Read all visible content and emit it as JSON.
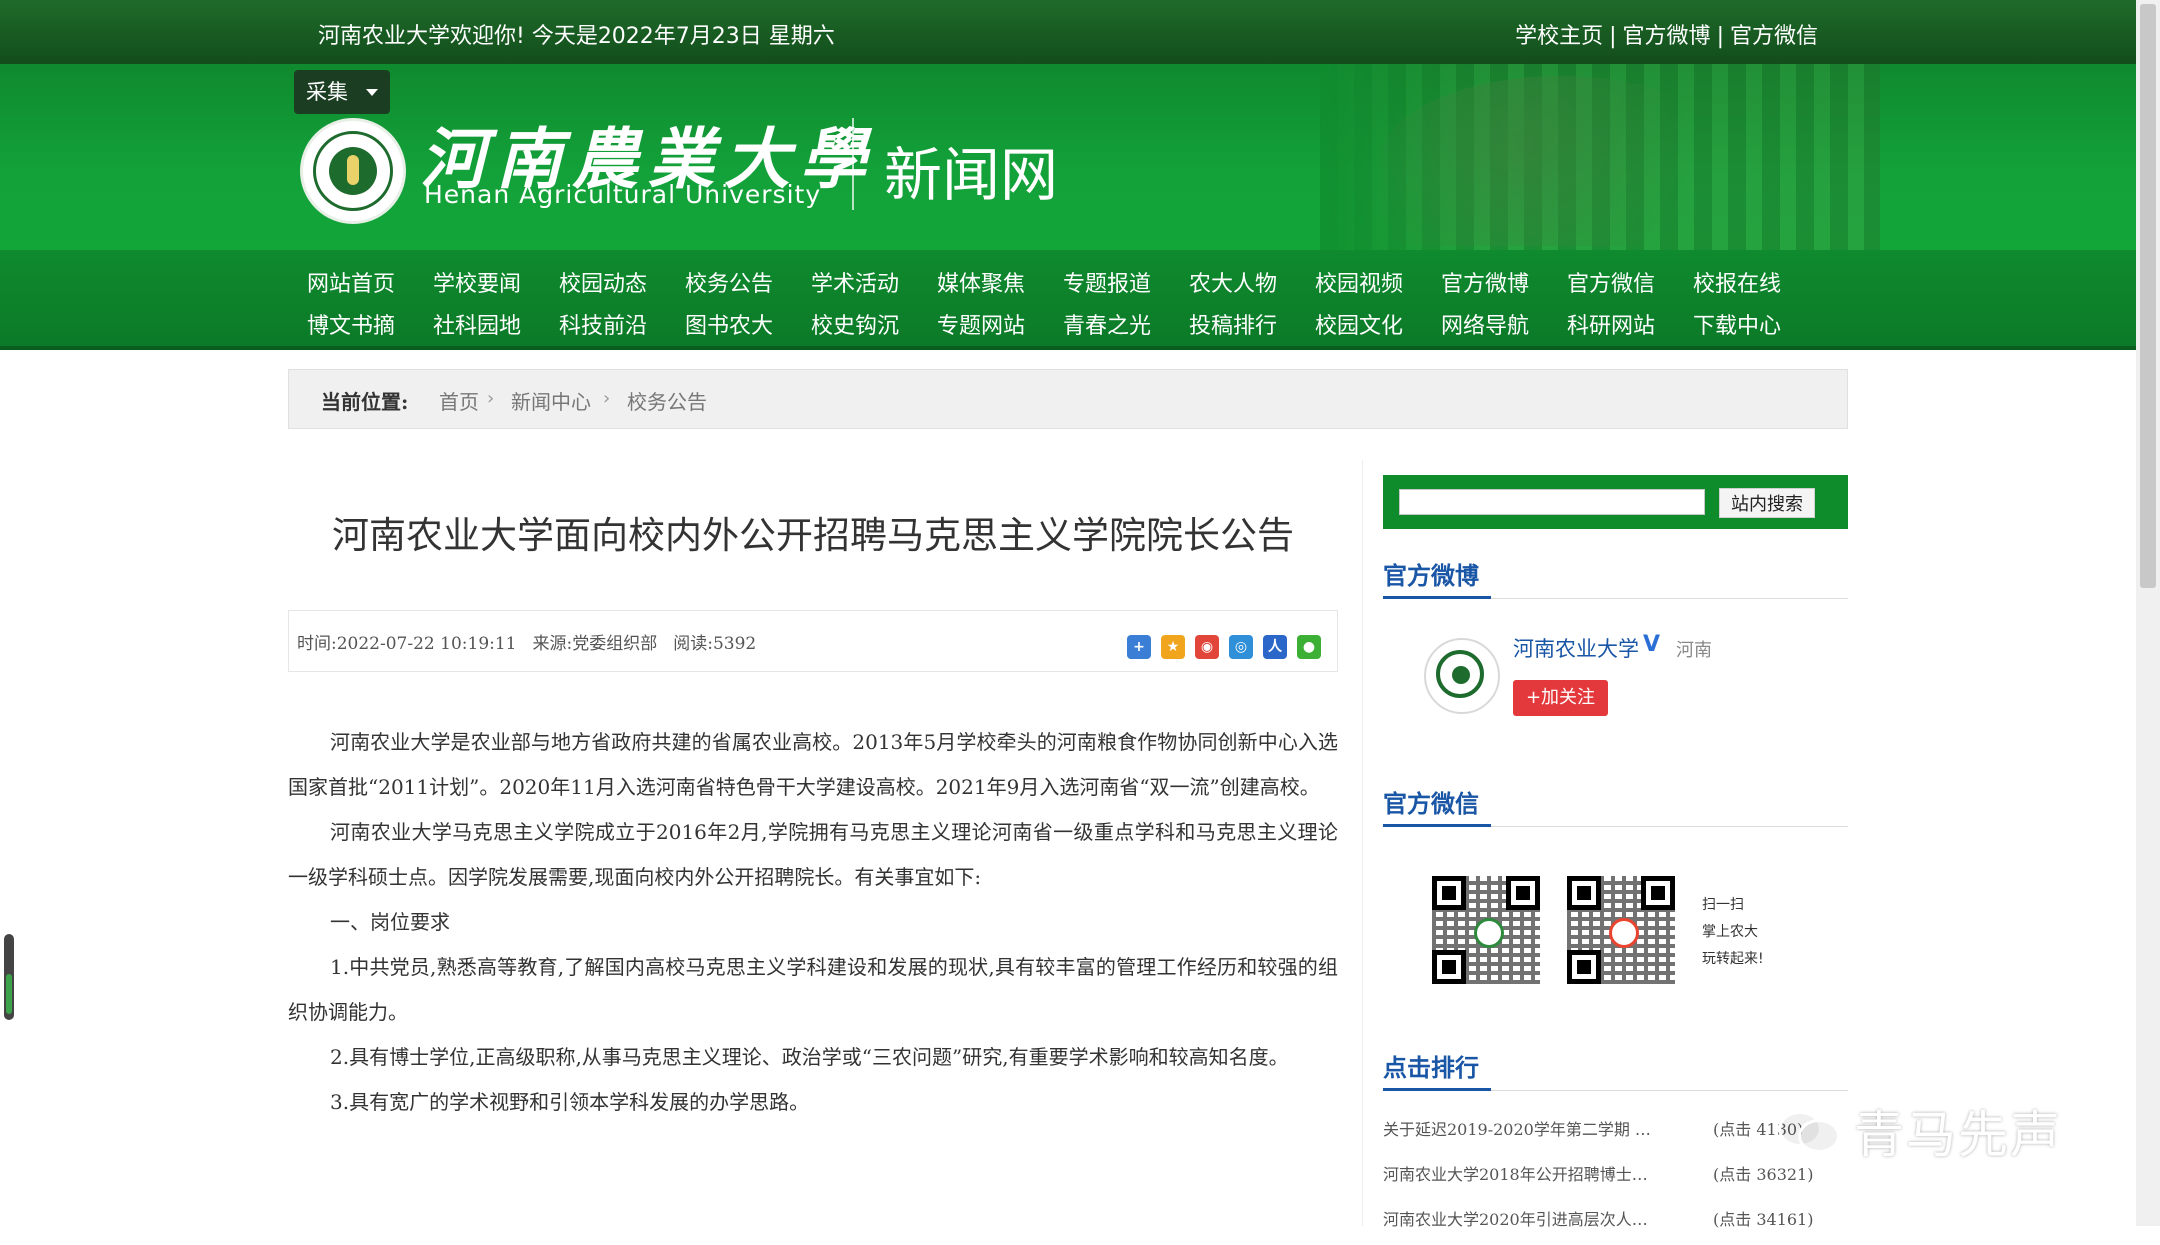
{
  "topbar": {
    "welcome": "河南农业大学欢迎你!  今天是2022年7月23日 星期六",
    "links": [
      "学校主页",
      "官方微博",
      "官方微信"
    ]
  },
  "header": {
    "collect_label": "采集",
    "logo_cn": "河南農業大學",
    "logo_en": "Henan Agricultural University",
    "site_name": "新闻网"
  },
  "nav": {
    "row1": [
      "网站首页",
      "学校要闻",
      "校园动态",
      "校务公告",
      "学术活动",
      "媒体聚焦",
      "专题报道",
      "农大人物",
      "校园视频",
      "官方微博",
      "官方微信",
      "校报在线"
    ],
    "row2": [
      "博文书摘",
      "社科园地",
      "科技前沿",
      "图书农大",
      "校史钩沉",
      "专题网站",
      "青春之光",
      "投稿排行",
      "校园文化",
      "网络导航",
      "科研网站",
      "下载中心"
    ]
  },
  "breadcrumb": {
    "label": "当前位置:",
    "home": "首页",
    "news": "新闻中心",
    "category": "校务公告"
  },
  "article": {
    "title": "河南农业大学面向校内外公开招聘马克思主义学院院长公告",
    "time": "时间:2022-07-22 10:19:11",
    "source": "来源:党委组织部",
    "reads": "阅读:5392",
    "paragraphs": [
      "河南农业大学是农业部与地方省政府共建的省属农业高校。2013年5月学校牵头的河南粮食作物协同创新中心入选国家首批“2011计划”。2020年11月入选河南省特色骨干大学建设高校。2021年9月入选河南省“双一流”创建高校。",
      "河南农业大学马克思主义学院成立于2016年2月,学院拥有马克思主义理论河南省一级重点学科和马克思主义理论一级学科硕士点。因学院发展需要,现面向校内外公开招聘院长。有关事宜如下:",
      "一、岗位要求",
      "1.中共党员,熟悉高等教育,了解国内高校马克思主义学科建设和发展的现状,具有较丰富的管理工作经历和较强的组织协调能力。",
      "2.具有博士学位,正高级职称,从事马克思主义理论、政治学或“三农问题”研究,有重要学术影响和较高知名度。",
      "3.具有宽广的学术视野和引领本学科发展的办学思路。"
    ]
  },
  "sidebar": {
    "search_button": "站内搜索",
    "weibo_title": "官方微博",
    "weibo_name": "河南农业大学",
    "weibo_location": "河南",
    "weibo_follow": "+加关注",
    "wechat_title": "官方微信",
    "wechat_caption": [
      "扫一扫",
      "掌上农大",
      "玩转起来!"
    ],
    "rank_title": "点击排行",
    "rank_items": [
      {
        "title": "关于延迟2019-2020学年第二学期 …",
        "count": "(点击  4130)"
      },
      {
        "title": "河南农业大学2018年公开招聘博士…",
        "count": "(点击  36321)"
      },
      {
        "title": "河南农业大学2020年引进高层次人…",
        "count": "(点击  34161)"
      }
    ]
  },
  "watermark": "青马先声",
  "colors": {
    "brand_green": "#0f8a2e",
    "dark_green": "#124d1b",
    "link_blue": "#1a56a6",
    "follow_red": "#e4393c"
  }
}
